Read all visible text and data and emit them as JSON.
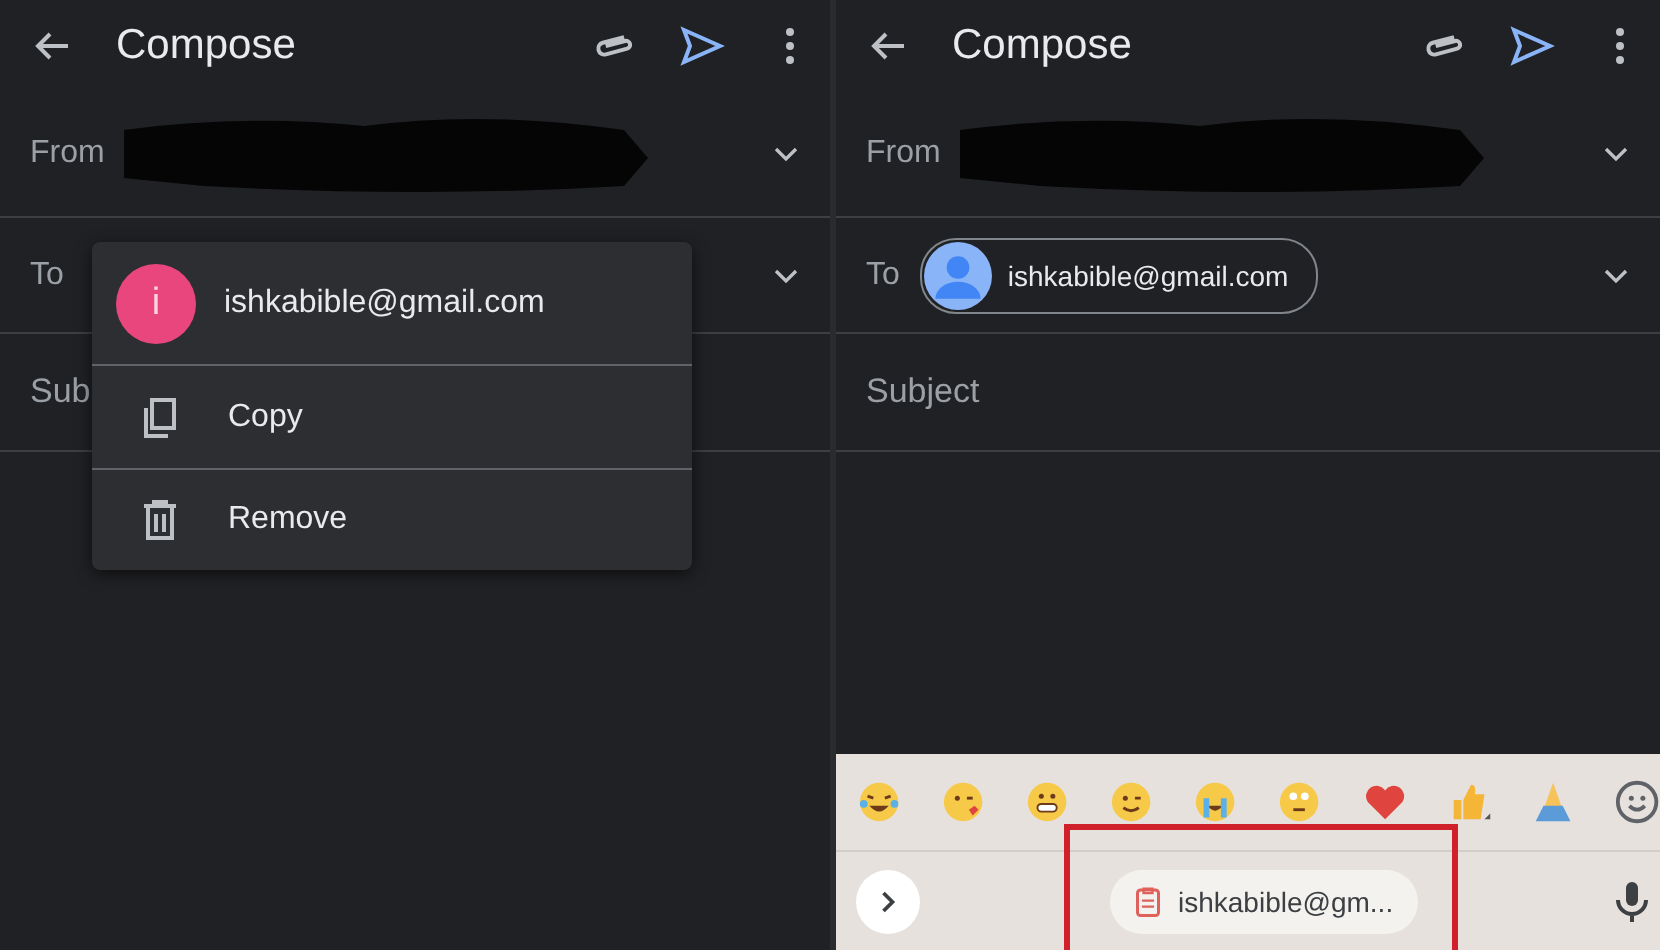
{
  "panels": [
    {
      "title": "Compose",
      "fields": [
        {
          "kind": "from",
          "label": "From",
          "redacted": true
        },
        {
          "kind": "to",
          "label": "To"
        },
        {
          "kind": "subject",
          "placeholder": "Sub"
        }
      ],
      "popup_menu": {
        "avatar_letter": "i",
        "email": "ishkabible@gmail.com",
        "items": [
          {
            "kind": "copy",
            "label": "Copy"
          },
          {
            "kind": "remove",
            "label": "Remove"
          }
        ]
      }
    },
    {
      "title": "Compose",
      "fields": [
        {
          "kind": "from",
          "label": "From",
          "redacted": true
        },
        {
          "kind": "to",
          "label": "To",
          "chip": "ishkabible@gmail.com"
        },
        {
          "kind": "subject",
          "placeholder": "Subject"
        }
      ],
      "keyboard": {
        "clipboard_suggestion": "ishkabible@gm...",
        "highlighted": true
      }
    }
  ]
}
